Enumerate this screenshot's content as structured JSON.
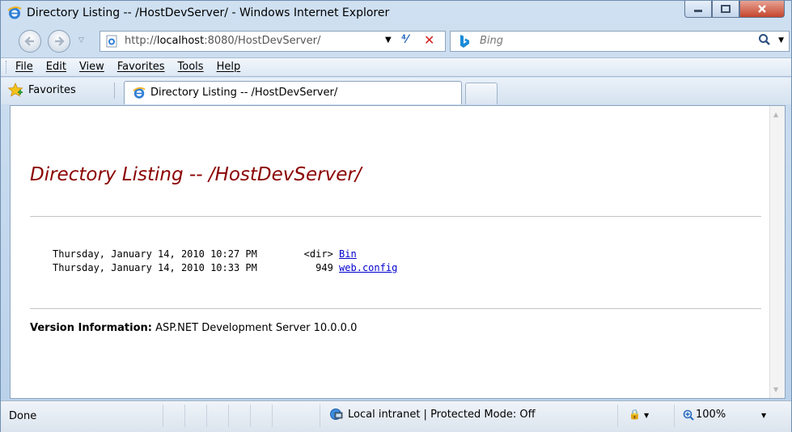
{
  "window": {
    "title": "Directory Listing -- /HostDevServer/ - Windows Internet Explorer",
    "controls": {
      "minimize": "minimize",
      "maximize": "maximize",
      "close": "close"
    }
  },
  "address_bar": {
    "url_prefix": "http://",
    "url_host": "localhost",
    "url_rest": ":8080/HostDevServer/"
  },
  "search": {
    "placeholder": "Bing"
  },
  "menu": {
    "items": [
      {
        "label": "File"
      },
      {
        "label": "Edit"
      },
      {
        "label": "View"
      },
      {
        "label": "Favorites"
      },
      {
        "label": "Tools"
      },
      {
        "label": "Help"
      }
    ]
  },
  "favorites_bar": {
    "favorites_label": "Favorites",
    "tab_title": "Directory Listing -- /HostDevServer/"
  },
  "page": {
    "heading": "Directory Listing -- /HostDevServer/",
    "listing": [
      {
        "date": "Thursday, January 14, 2010 10:27 PM",
        "size": " <dir>",
        "name": "Bin"
      },
      {
        "date": "Thursday, January 14, 2010 10:33 PM",
        "size": "   949",
        "name": "web.config"
      }
    ],
    "version_label": "Version Information:",
    "version_value": " ASP.NET Development Server 10.0.0.0"
  },
  "status_bar": {
    "status": "Done",
    "zone": "Local intranet | Protected Mode: Off",
    "zoom": "100%"
  },
  "colors": {
    "heading": "#8b0000",
    "link": "#0000cc",
    "chrome": "#cfe0f1"
  }
}
